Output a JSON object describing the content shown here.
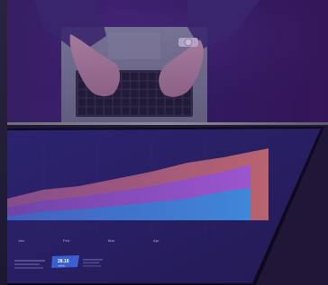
{
  "photo": {
    "subject": "hands-typing-on-laptop"
  },
  "chart": {
    "type": "area",
    "x_tick_labels": [
      "Jan",
      "Feb",
      "Mar",
      "Apr"
    ],
    "badge": {
      "value": "28.10",
      "sub_label": "metric"
    },
    "colors": {
      "band_top": "#b45e76",
      "band_middle": "#7a47c7",
      "band_bottom": "#3f7fd3",
      "screen_background": "#2a1f66"
    }
  }
}
